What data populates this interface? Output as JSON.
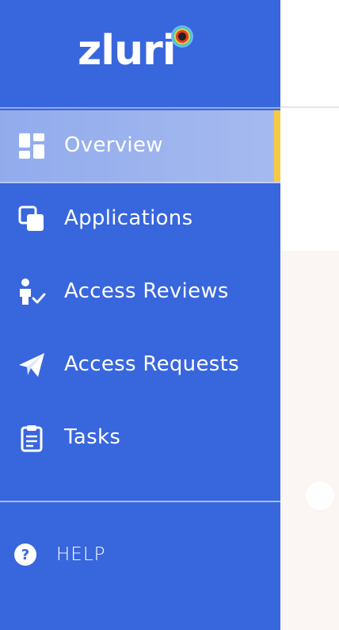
{
  "brand": {
    "name": "zluri"
  },
  "sidebar": {
    "items": [
      {
        "label": "Overview",
        "icon": "dashboard-icon",
        "active": true
      },
      {
        "label": "Applications",
        "icon": "applications-icon",
        "active": false
      },
      {
        "label": "Access Reviews",
        "icon": "access-review-icon",
        "active": false
      },
      {
        "label": "Access Requests",
        "icon": "paper-plane-icon",
        "active": false
      },
      {
        "label": "Tasks",
        "icon": "clipboard-icon",
        "active": false
      }
    ],
    "help_label": "HELP"
  },
  "colors": {
    "sidebar_bg": "#3866dd",
    "active_indicator": "#f6c945",
    "content_bg": "#fbf6f3"
  }
}
